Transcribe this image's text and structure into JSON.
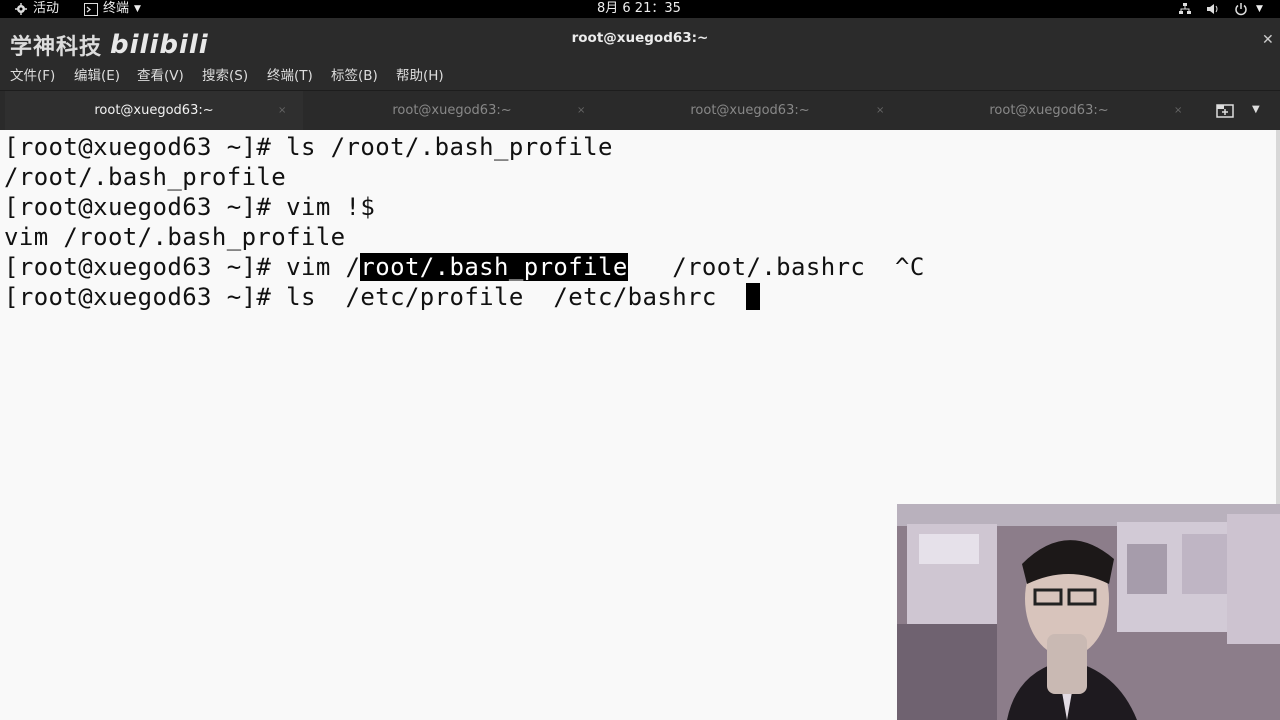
{
  "system_bar": {
    "activities": "活动",
    "app_menu": "终端",
    "clock": "8月 6 21：35"
  },
  "watermark": {
    "brand_text": "学神科技",
    "logo_text": "bilibili"
  },
  "window": {
    "title": "root@xuegod63:~"
  },
  "menu": {
    "items": [
      "文件(F)",
      "编辑(E)",
      "查看(V)",
      "搜索(S)",
      "终端(T)",
      "标签(B)",
      "帮助(H)"
    ]
  },
  "tabs": [
    {
      "label": "root@xuegod63:~",
      "active": true
    },
    {
      "label": "root@xuegod63:~",
      "active": false
    },
    {
      "label": "root@xuegod63:~",
      "active": false
    },
    {
      "label": "root@xuegod63:~",
      "active": false
    }
  ],
  "terminal": {
    "line1": "[root@xuegod63 ~]# ls /root/.bash_profile",
    "line2": "/root/.bash_profile",
    "line3": "[root@xuegod63 ~]# vim !$",
    "line4": "vim /root/.bash_profile",
    "line5_before": "[root@xuegod63 ~]# vim /",
    "line5_highlight": "root/.bash_profile",
    "line5_after": "   /root/.bashrc  ^C",
    "line6": "[root@xuegod63 ~]# ls  /etc/profile  /etc/bashrc  "
  },
  "colors": {
    "terminal_bg": "#f9f9f9",
    "chrome_bg": "#2b2b2b",
    "topbar_bg": "#000000"
  }
}
